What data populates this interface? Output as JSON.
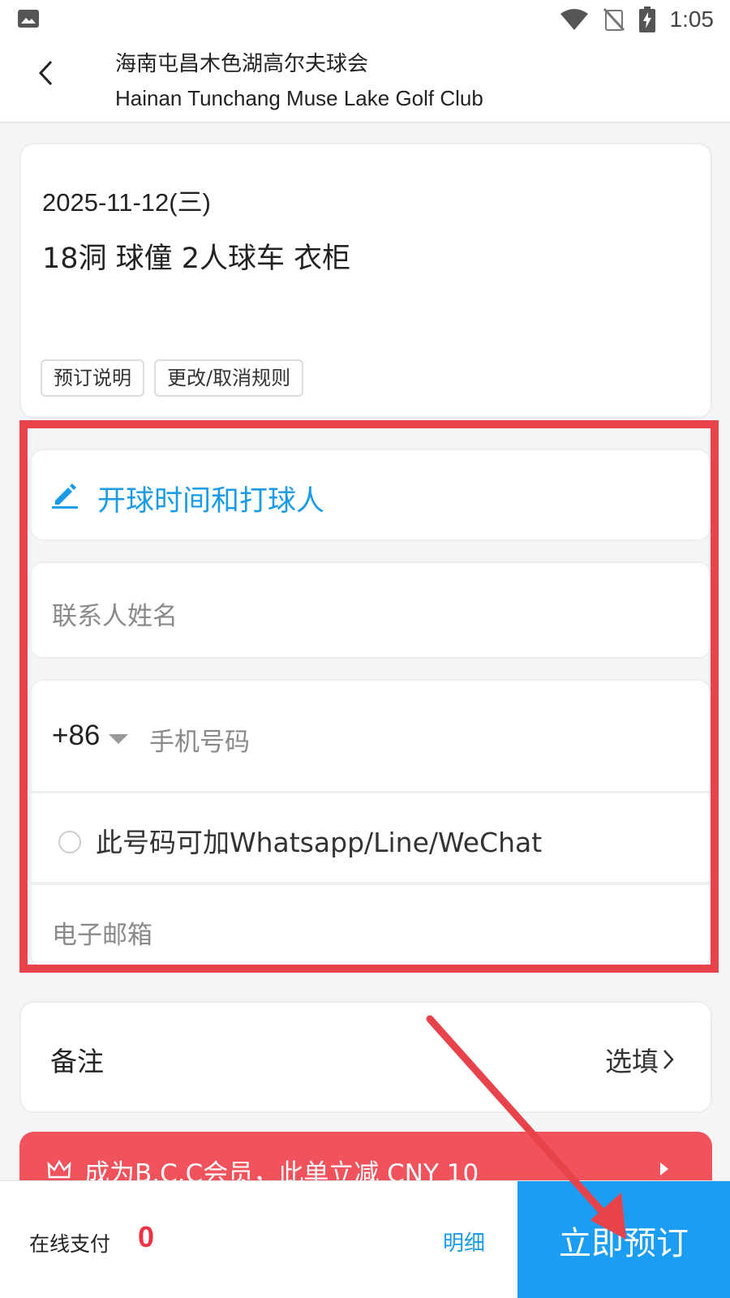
{
  "status_bar": {
    "time": "1:05",
    "icons": [
      "image-icon",
      "wifi-icon",
      "no-signal-icon",
      "battery-charging-icon"
    ]
  },
  "header": {
    "title_cn": "海南屯昌木色湖高尔夫球会",
    "title_en": "Hainan Tunchang Muse Lake Golf Club"
  },
  "order": {
    "date": "2025-11-12(三)",
    "items": "18洞 球僮 2人球车 衣柜",
    "tags": [
      "预订说明",
      "更改/取消规则"
    ]
  },
  "form": {
    "tee_time_label": "开球时间和打球人",
    "contact_name_placeholder": "联系人姓名",
    "country_code": "+86",
    "phone_placeholder": "手机号码",
    "messaging_option": "此号码可加Whatsapp/Line/WeChat",
    "email_placeholder": "电子邮箱"
  },
  "note": {
    "label": "备注",
    "option": "选填"
  },
  "member_banner": {
    "text": "成为B.C.C会员，此单立减 CNY 10"
  },
  "bottom_bar": {
    "pay_label": "在线支付",
    "pay_amount": "0",
    "detail_label": "明细",
    "book_label": "立即预订"
  },
  "colors": {
    "accent_blue": "#1a9df2",
    "highlight_red": "#e8424a",
    "banner_red": "#f0535c",
    "amount_red": "#ec3344"
  }
}
